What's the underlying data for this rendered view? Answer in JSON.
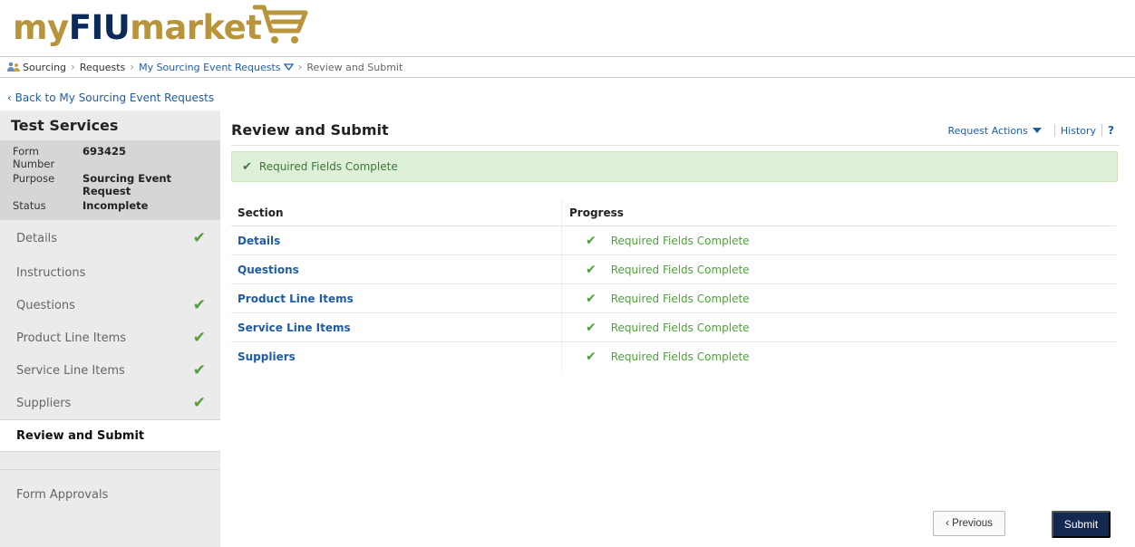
{
  "logo": {
    "part1": "my",
    "part2": "FIU",
    "part3": "market"
  },
  "breadcrumb": {
    "sourcing": "Sourcing",
    "requests": "Requests",
    "my_requests": "My Sourcing Event Requests",
    "current": "Review and Submit"
  },
  "back_link": "‹ Back to My Sourcing Event Requests",
  "sidebar": {
    "title": "Test Services",
    "meta": {
      "form_number_label": "Form Number",
      "form_number": "693425",
      "purpose_label": "Purpose",
      "purpose": "Sourcing Event Request",
      "status_label": "Status",
      "status": "Incomplete"
    },
    "items": [
      {
        "label": "Details",
        "complete": true
      },
      {
        "label": "Instructions",
        "complete": false
      },
      {
        "label": "Questions",
        "complete": true
      },
      {
        "label": "Product Line Items",
        "complete": true
      },
      {
        "label": "Service Line Items",
        "complete": true
      },
      {
        "label": "Suppliers",
        "complete": true
      }
    ],
    "active": "Review and Submit",
    "approvals": "Form Approvals"
  },
  "main": {
    "title": "Review and Submit",
    "request_actions": "Request Actions",
    "history": "History",
    "help": "?",
    "banner": "Required Fields Complete",
    "table": {
      "col_section": "Section",
      "col_progress": "Progress",
      "rows": [
        {
          "section": "Details",
          "progress": "Required Fields Complete"
        },
        {
          "section": "Questions",
          "progress": "Required Fields Complete"
        },
        {
          "section": "Product Line Items",
          "progress": "Required Fields Complete"
        },
        {
          "section": "Service Line Items",
          "progress": "Required Fields Complete"
        },
        {
          "section": "Suppliers",
          "progress": "Required Fields Complete"
        }
      ]
    },
    "previous": "‹ Previous",
    "submit": "Submit"
  },
  "colors": {
    "logo_gold": "#b8953a",
    "logo_navy": "#0a2a5c",
    "link_blue": "#1f5ca8",
    "check_green": "#52a03a",
    "submit_navy": "#14294f"
  },
  "icons": {
    "check": "checkmark-icon",
    "cart": "shopping-cart-icon",
    "user": "user-group-icon"
  }
}
